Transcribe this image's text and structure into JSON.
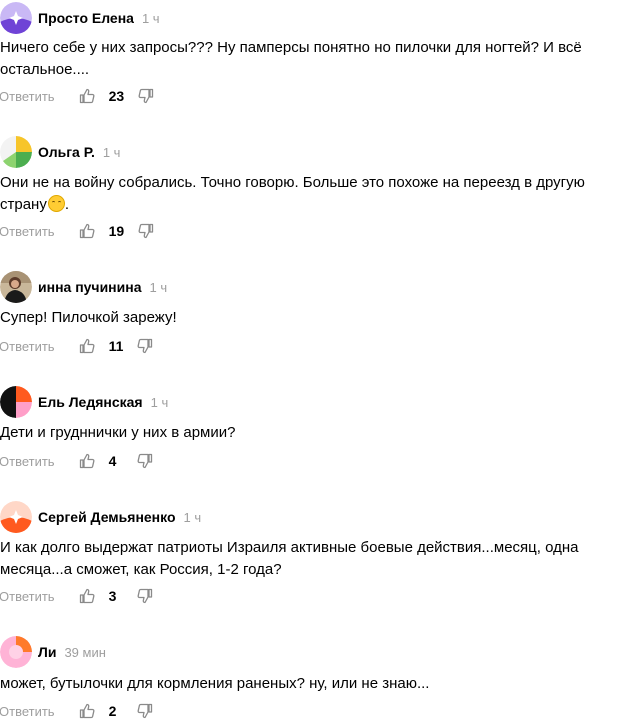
{
  "ui": {
    "reply_label": "Ответить"
  },
  "comments": [
    {
      "author": "Просто Елена",
      "time": "1 ч",
      "text": "Ничего себе у них запросы??? Ну памперсы понятно но пилочки для ногтей? И всё остальное....",
      "likes": "23",
      "avatar": "purple-star"
    },
    {
      "author": "Ольга Р.",
      "time": "1 ч",
      "text": "Они не на войну собрались. Точно говорю. Больше это похоже на переезд в другую страну",
      "text_end": ".",
      "emoji": "smiling-face",
      "likes": "19",
      "avatar": "yellow-green-leaf"
    },
    {
      "author": "инна пучинина",
      "time": "1 ч",
      "text": "Супер! Пилочкой зарежу!",
      "likes": "11",
      "avatar": "photo"
    },
    {
      "author": "Ель Ледянская",
      "time": "1 ч",
      "text": "Дети и грудннички у них в армии?",
      "likes": "4",
      "avatar": "orange-black-pink"
    },
    {
      "author": "Сергей Демьяненко",
      "time": "1 ч",
      "text": "И как долго выдержат патриоты Израиля активные боевые действия...месяц, одна месяца...а сможет, как Россия, 1-2 года?",
      "likes": "3",
      "avatar": "orange-star"
    },
    {
      "author": "Ли",
      "time": "39 мин",
      "text": "может, бутылочки для кормления раненых? ну, или не знаю...",
      "likes": "2",
      "avatar": "pink-orange"
    }
  ],
  "colors": {
    "meta_gray": "#9e9e9e",
    "icon_gray": "#8a8a8a",
    "text": "#000000"
  }
}
